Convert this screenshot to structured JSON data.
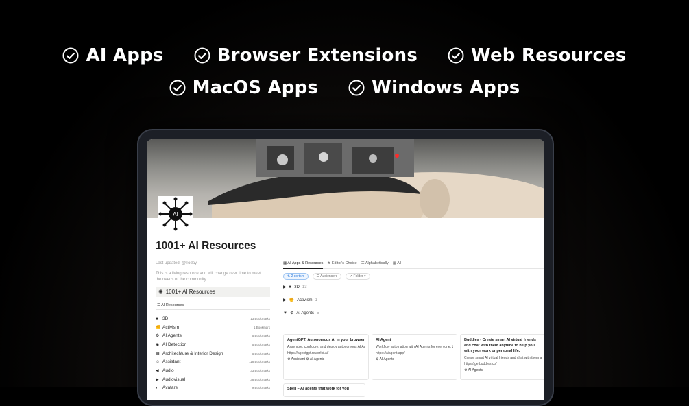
{
  "features": {
    "row1": [
      "AI Apps",
      "Browser Extensions",
      "Web Resources"
    ],
    "row2": [
      "MacOS Apps",
      "Windows Apps"
    ]
  },
  "page": {
    "title": "1001+ AI Resources",
    "last_updated": "Last updated: @Today",
    "description_line1": "This is a living resource and will change over time to meet",
    "description_line2": "the needs of the community.",
    "section_title": "1001+ AI Resources",
    "section_tab": "AI Resources"
  },
  "categories": [
    {
      "icon": "■",
      "name": "3D",
      "count": "13 Bookmarks"
    },
    {
      "icon": "✊",
      "name": "Activism",
      "count": "1 Bookmark"
    },
    {
      "icon": "⚙",
      "name": "AI Agents",
      "count": "5 Bookmarks"
    },
    {
      "icon": "◉",
      "name": "AI Detection",
      "count": "5 Bookmarks"
    },
    {
      "icon": "▦",
      "name": "Architechture & Interior Design",
      "count": "5 Bookmarks"
    },
    {
      "icon": "☺",
      "name": "Assistant",
      "count": "118 Bookmarks"
    },
    {
      "icon": "◀",
      "name": "Audio",
      "count": "33 Bookmarks"
    },
    {
      "icon": "▶",
      "name": "Audiovisual",
      "count": "38 Bookmarks"
    },
    {
      "icon": "◐",
      "name": "Avatars",
      "count": "9 Bookmarks"
    }
  ],
  "views": {
    "tabs": [
      "AI Apps & Resources",
      "Editor's Choice",
      "Alphabetically",
      "All"
    ],
    "filters": [
      "2 sorts",
      "Audience",
      "Folder"
    ]
  },
  "groups": [
    {
      "icon": "■",
      "name": "3D",
      "count": "13"
    },
    {
      "icon": "✊",
      "name": "Activism",
      "count": "1"
    },
    {
      "icon": "⚙",
      "name": "AI Agents",
      "count": "5"
    }
  ],
  "cards": [
    {
      "title": "AgentGPT: Autonomous AI in your browser",
      "desc": "Assemble, configure, and deploy autonomous AI Agents",
      "url": "https://agentgpt.reworkd.ai/",
      "tag1": "Assistant",
      "tag2": "AI Agents"
    },
    {
      "title": "AI Agent",
      "desc": "Workflow automation with AI Agents for everyone. U",
      "url": "https://aiagent.app/",
      "tag1": "AI Agents",
      "tag2": ""
    },
    {
      "title": "Buddies - Create smart AI virtual friends and chat with them anytime to help you with your work or personal life.",
      "desc": "Create smart AI virtual friends and chat with them any",
      "url": "https://getbuddies.co/",
      "tag1": "AI Agents",
      "tag2": ""
    }
  ],
  "card_extra": {
    "title": "Spell – AI agents that work for you"
  }
}
